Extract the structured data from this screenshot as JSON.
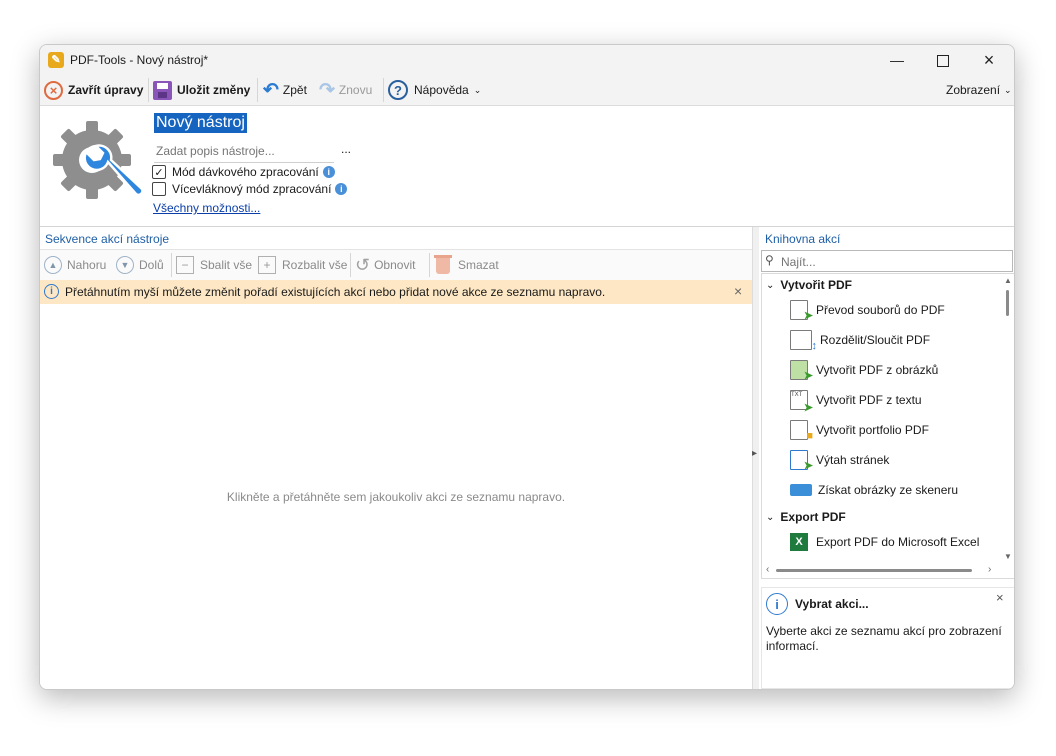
{
  "window": {
    "title": "PDF-Tools - Nový nástroj*",
    "app_icon": "pdf-tools-icon"
  },
  "toolbar": {
    "close_edit": "Zavřít úpravy",
    "save": "Uložit změny",
    "undo": "Zpět",
    "redo": "Znovu",
    "help": "Nápověda",
    "view": "Zobrazení"
  },
  "tool": {
    "name": "Nový nástroj",
    "description_placeholder": "Zadat popis nástroje...",
    "more_button": "...",
    "batch_mode_label": "Mód dávkového zpracování",
    "batch_mode_checked": true,
    "multithread_label": "Vícevláknový mód zpracování",
    "multithread_checked": false,
    "all_options_link": "Všechny možnosti..."
  },
  "sequence": {
    "title": "Sekvence akcí nástroje",
    "buttons": {
      "up": "Nahoru",
      "down": "Dolů",
      "collapse_all": "Sbalit vše",
      "expand_all": "Rozbalit vše",
      "restore": "Obnovit",
      "delete": "Smazat"
    },
    "info_text": "Přetáhnutím myší můžete změnit pořadí existujících akcí nebo přidat nové akce ze seznamu napravo.",
    "empty_text": "Klikněte a přetáhněte sem jakoukoliv akci ze seznamu napravo."
  },
  "library": {
    "title": "Knihovna akcí",
    "search_placeholder": "Najít...",
    "groups": [
      {
        "label": "Vytvořit PDF",
        "items": [
          "Převod souborů do PDF",
          "Rozdělit/Sloučit PDF",
          "Vytvořit PDF z obrázků",
          "Vytvořit PDF z textu",
          "Vytvořit portfolio PDF",
          "Výtah stránek",
          "Získat obrázky ze skeneru"
        ]
      },
      {
        "label": "Export PDF",
        "items": [
          "Export PDF do Microsoft Excel"
        ]
      }
    ]
  },
  "details": {
    "title": "Vybrat akci...",
    "text": "Vyberte akci ze seznamu akcí pro zobrazení informací."
  },
  "colors": {
    "accent": "#1f5fa6",
    "info_bar": "#fde7c4",
    "selection": "#1565c0",
    "title_bar": "#f3f3f3"
  }
}
